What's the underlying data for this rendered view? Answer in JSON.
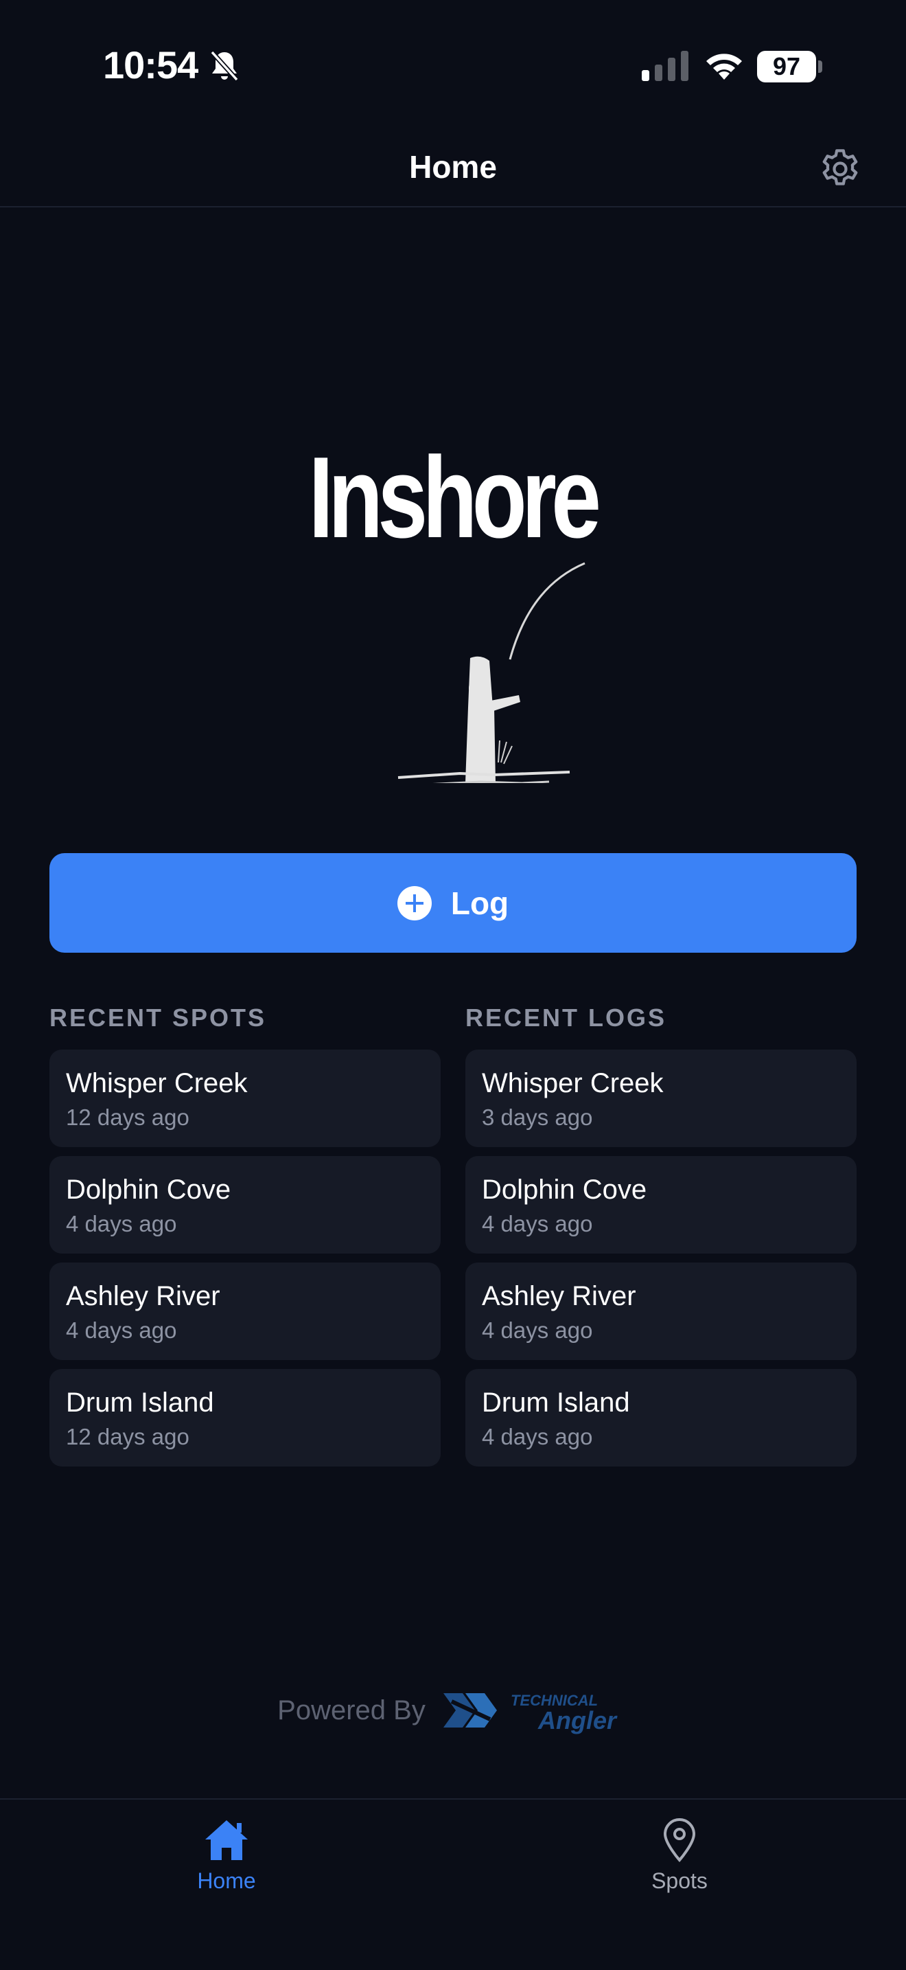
{
  "status_bar": {
    "time": "10:54",
    "battery": "97"
  },
  "header": {
    "title": "Home"
  },
  "hero": {
    "title": "Inshore"
  },
  "log_button": {
    "label": "Log"
  },
  "recent_spots": {
    "header": "RECENT SPOTS",
    "items": [
      {
        "name": "Whisper Creek",
        "time": "12 days ago"
      },
      {
        "name": "Dolphin Cove",
        "time": "4 days ago"
      },
      {
        "name": "Ashley River",
        "time": "4 days ago"
      },
      {
        "name": "Drum Island",
        "time": "12 days ago"
      }
    ]
  },
  "recent_logs": {
    "header": "RECENT LOGS",
    "items": [
      {
        "name": "Whisper Creek",
        "time": "3 days ago"
      },
      {
        "name": "Dolphin Cove",
        "time": "4 days ago"
      },
      {
        "name": "Ashley River",
        "time": "4 days ago"
      },
      {
        "name": "Drum Island",
        "time": "4 days ago"
      }
    ]
  },
  "footer": {
    "powered_by": "Powered By",
    "brand_line1": "TECHNICAL",
    "brand_line2": "Angler"
  },
  "tabs": [
    {
      "label": "Home",
      "active": true
    },
    {
      "label": "Spots",
      "active": false
    }
  ],
  "colors": {
    "background": "#0a0d17",
    "accent": "#3b82f6",
    "card": "#161a26",
    "muted_text": "#8d93a3"
  }
}
